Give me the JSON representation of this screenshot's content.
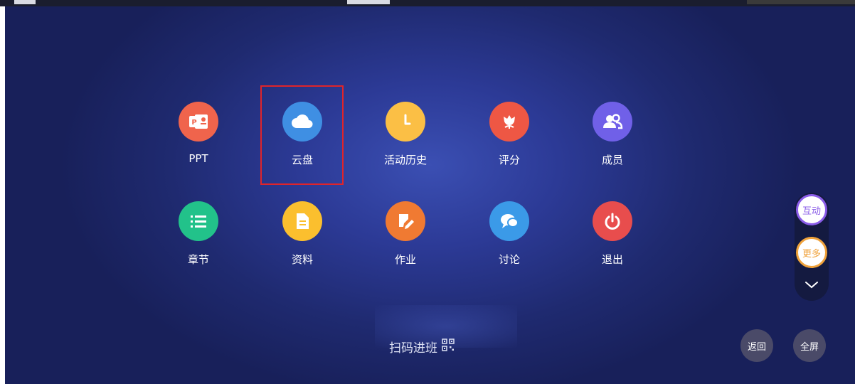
{
  "menu": {
    "items": [
      {
        "label": "PPT",
        "icon": "ppt-icon",
        "color": "#f0644c"
      },
      {
        "label": "云盘",
        "icon": "cloud-icon",
        "color": "#3f8fe3"
      },
      {
        "label": "活动历史",
        "icon": "clock-icon",
        "color": "#fbbf45"
      },
      {
        "label": "评分",
        "icon": "flower-icon",
        "color": "#ee5744"
      },
      {
        "label": "成员",
        "icon": "members-icon",
        "color": "#7060e8"
      },
      {
        "label": "章节",
        "icon": "list-icon",
        "color": "#22c28a"
      },
      {
        "label": "资料",
        "icon": "document-icon",
        "color": "#fbbf2e"
      },
      {
        "label": "作业",
        "icon": "edit-icon",
        "color": "#f07a32"
      },
      {
        "label": "讨论",
        "icon": "chat-icon",
        "color": "#3b9ae8"
      },
      {
        "label": "退出",
        "icon": "power-icon",
        "color": "#e84d4d"
      }
    ]
  },
  "scan_join": {
    "label": "扫码进班",
    "icon": "qr-code-icon"
  },
  "side": {
    "interact_label": "互动",
    "interact_color": "#8a5ce8",
    "more_label": "更多",
    "more_color": "#f0a23a",
    "collapse_icon": "chevron-down-icon"
  },
  "bottom": {
    "back_label": "返回",
    "fullscreen_label": "全屏"
  },
  "highlight_color": "#e0242a"
}
